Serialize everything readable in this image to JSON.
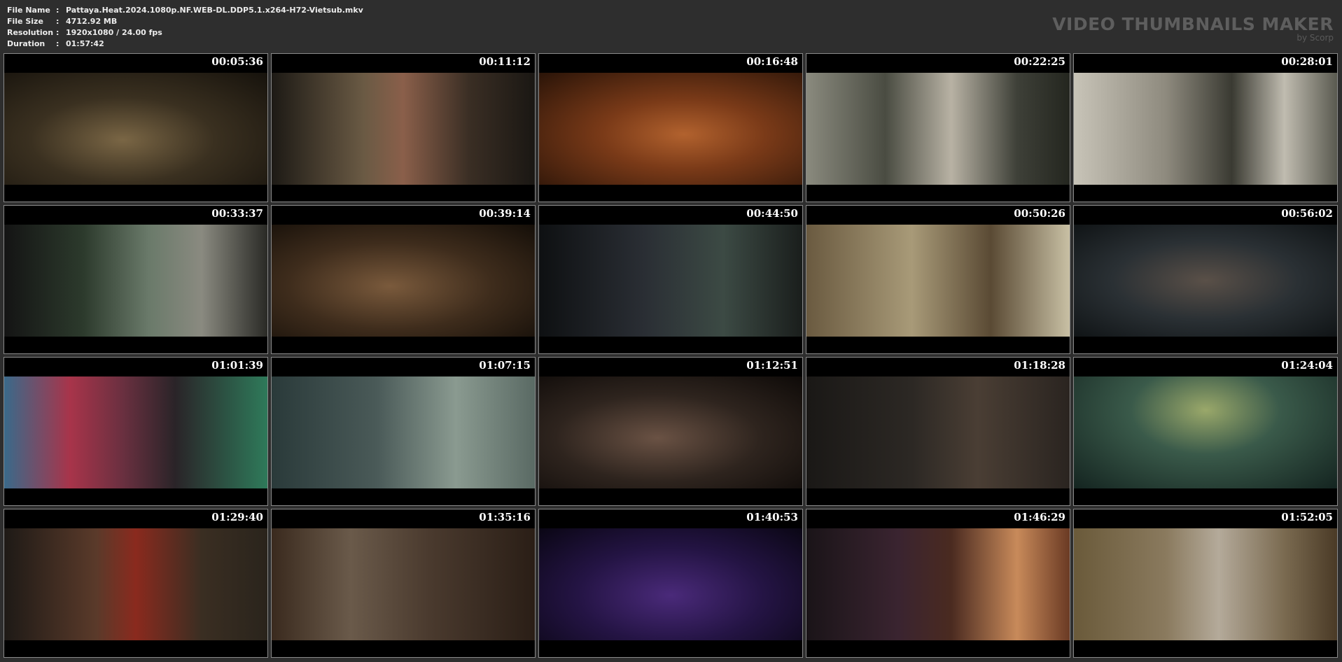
{
  "info": {
    "file_name_label": "File Name",
    "file_name": "Pattaya.Heat.2024.1080p.NF.WEB-DL.DDP5.1.x264-H72-Vietsub.mkv",
    "file_size_label": "File Size",
    "file_size": "4712.92 MB",
    "resolution_label": "Resolution",
    "resolution": "1920x1080 / 24.00 fps",
    "duration_label": "Duration",
    "duration": "01:57:42",
    "separator": ":"
  },
  "brand": {
    "title": "VIDEO THUMBNAILS MAKER",
    "subtitle": "by Scorp"
  },
  "thumbnails": [
    {
      "time": "00:05:36"
    },
    {
      "time": "00:11:12"
    },
    {
      "time": "00:16:48"
    },
    {
      "time": "00:22:25"
    },
    {
      "time": "00:28:01"
    },
    {
      "time": "00:33:37"
    },
    {
      "time": "00:39:14"
    },
    {
      "time": "00:44:50"
    },
    {
      "time": "00:50:26"
    },
    {
      "time": "00:56:02"
    },
    {
      "time": "01:01:39"
    },
    {
      "time": "01:07:15"
    },
    {
      "time": "01:12:51"
    },
    {
      "time": "01:18:28"
    },
    {
      "time": "01:24:04"
    },
    {
      "time": "01:29:40"
    },
    {
      "time": "01:35:16"
    },
    {
      "time": "01:40:53"
    },
    {
      "time": "01:46:29"
    },
    {
      "time": "01:52:05"
    }
  ]
}
